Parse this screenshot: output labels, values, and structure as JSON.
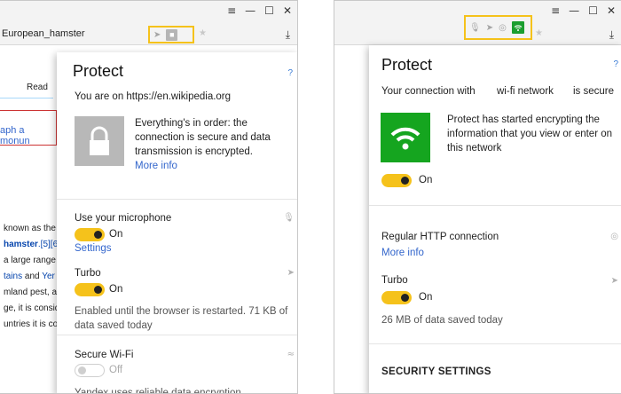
{
  "left": {
    "window_controls": [
      "≡",
      "—",
      "☐",
      "✕"
    ],
    "address": "European_hamster",
    "wiki": {
      "read_tab": "Read",
      "boxed_link": "aph a monun",
      "lines": [
        {
          "a": "known as the",
          "b": ""
        },
        {
          "a": "",
          "b": "hamster",
          "c": ".[5][6"
        },
        {
          "a": "a large range",
          "b": ""
        },
        {
          "a": "",
          "b": "tains",
          "c": " and ",
          "d": "Yer"
        },
        {
          "a": "mland pest, a",
          "b": ""
        },
        {
          "a": "ge, it is consid",
          "b": ""
        },
        {
          "a": "untries it is co",
          "b": ""
        }
      ]
    },
    "popup": {
      "title": "Protect",
      "help": "?",
      "site": "You are on https://en.wikipedia.org",
      "status": "Everything's in order: the connection is secure and data transmission is encrypted.",
      "more_info": "More info",
      "microphone_label": "Use your microphone",
      "microphone_state": "On",
      "settings": "Settings",
      "turbo_label": "Turbo",
      "turbo_state": "On",
      "turbo_note": "Enabled until the browser is restarted. 71 KB of data saved today",
      "wifi_label": "Secure Wi-Fi",
      "wifi_state": "Off",
      "wifi_note": "Yandex uses reliable data encryption"
    }
  },
  "right": {
    "window_controls": [
      "≡",
      "—",
      "☐",
      "✕"
    ],
    "popup": {
      "title": "Protect",
      "help": "?",
      "conn_prefix": "Your connection with",
      "conn_network": "wi-fi network",
      "conn_suffix": "is secure",
      "status": "Protect has started encrypting the information that you view or enter on this network",
      "toggle_state": "On",
      "http_label": "Regular HTTP connection",
      "more_info": "More info",
      "turbo_label": "Turbo",
      "turbo_state": "On",
      "turbo_note": "26 MB of data saved today",
      "security_settings": "SECURITY SETTINGS"
    }
  },
  "colors": {
    "highlight": "#f5c21b",
    "toggle_on": "#f5c21b",
    "link": "#3366cc",
    "wifi_green": "#15a51f",
    "lock_grey": "#b8b8b8"
  },
  "icons": {
    "left_address": [
      "rocket-icon",
      "lock-icon",
      "star-icon",
      "download-icon"
    ],
    "right_address": [
      "microphone-icon",
      "rocket-icon",
      "shield-icon",
      "wifi-icon",
      "star-icon",
      "download-icon"
    ]
  }
}
